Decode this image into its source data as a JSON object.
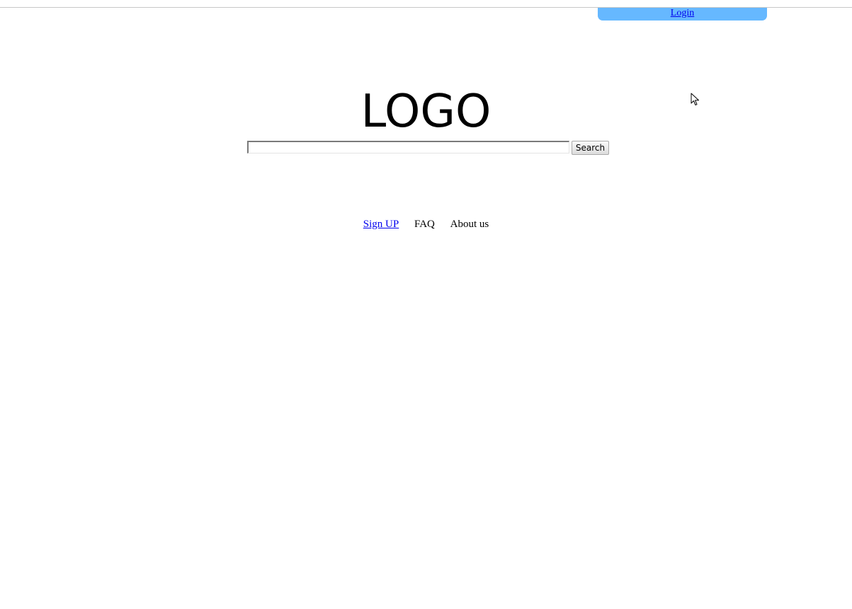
{
  "header": {
    "login_label": "Login",
    "bar_color": "#66b8ff",
    "link_color": "#0000ee"
  },
  "main": {
    "logo_text": "LOGO",
    "search": {
      "value": "",
      "placeholder": "",
      "button_label": "Search"
    }
  },
  "footer": {
    "links": [
      {
        "label": "Sign UP",
        "style": "hyperlink"
      },
      {
        "label": "FAQ",
        "style": "plain"
      },
      {
        "label": "About us",
        "style": "plain"
      }
    ]
  },
  "icons": {
    "cursor": "mouse-pointer-arrow"
  }
}
